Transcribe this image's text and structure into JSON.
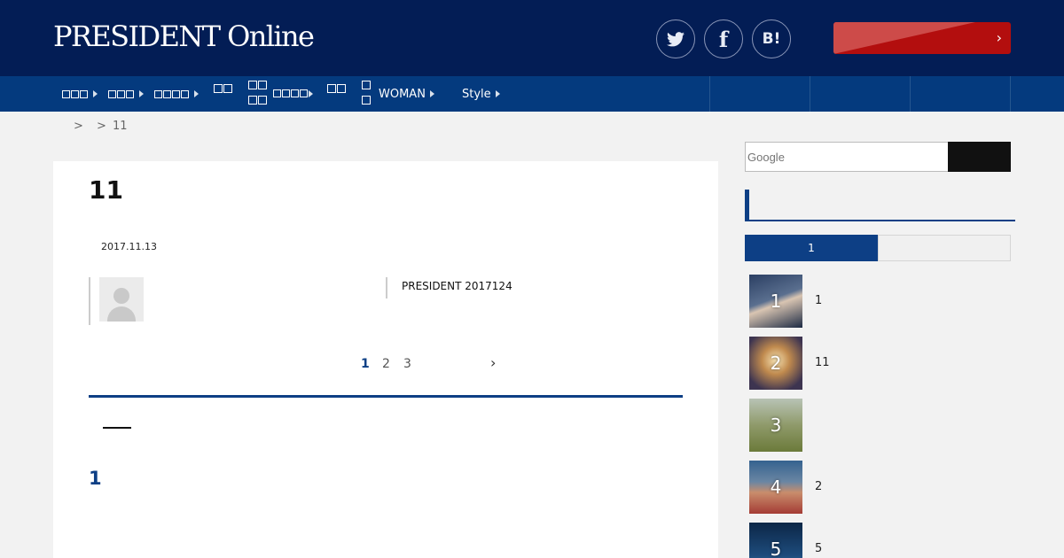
{
  "header": {
    "logo": "PRESIDENT Online",
    "social": {
      "twitter_icon": "twitter-icon",
      "facebook_label": "f",
      "hatena_label": "B!"
    },
    "cta": {
      "chevron": "›"
    },
    "colors": {
      "header_bg": "#031d55",
      "nav_bg": "#043a7e",
      "cta_bg": "#b30e0e",
      "accent": "#0d3f85"
    }
  },
  "nav": {
    "woman": "WOMAN",
    "style": "Style"
  },
  "breadcrumb": {
    "sep1": ">",
    "sep2": ">",
    "current": "11"
  },
  "article": {
    "title": "11",
    "date": "2017.11.13",
    "source": "PRESIDENT 2017124",
    "pagination": {
      "pages": [
        "1",
        "2",
        "3"
      ],
      "next": "›"
    },
    "section_number": "1"
  },
  "sidebar": {
    "search_placeholder": "Google",
    "tab_active": "1",
    "ranking": [
      {
        "rank": "1",
        "title": "1"
      },
      {
        "rank": "2",
        "title": "11"
      },
      {
        "rank": "3",
        "title": ""
      },
      {
        "rank": "4",
        "title": "2"
      },
      {
        "rank": "5",
        "title": "5"
      }
    ]
  }
}
